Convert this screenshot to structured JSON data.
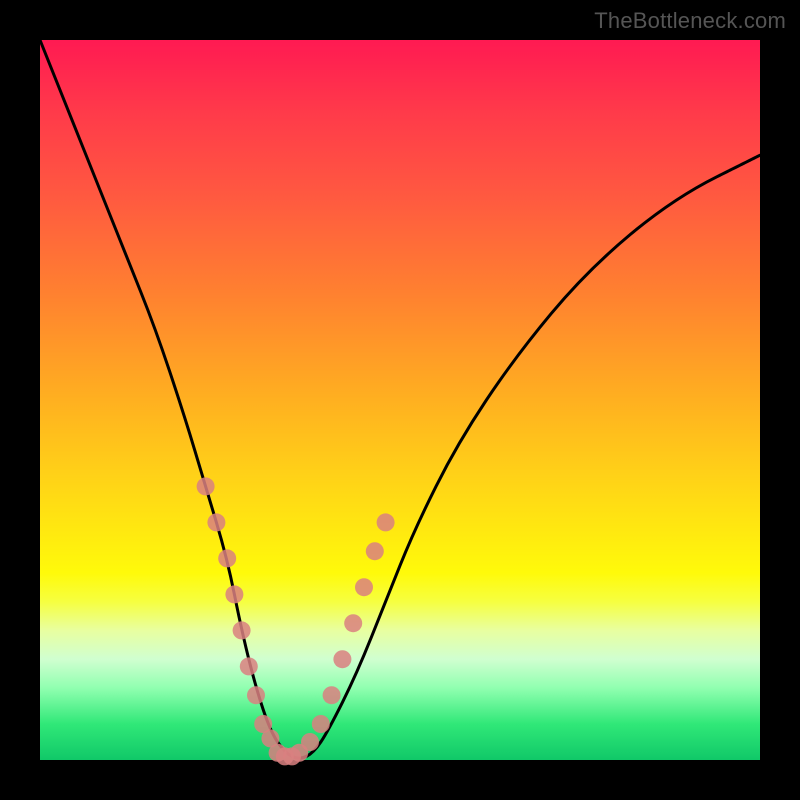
{
  "watermark": "TheBottleneck.com",
  "chart_data": {
    "type": "line",
    "title": "",
    "xlabel": "",
    "ylabel": "",
    "xlim": [
      0,
      100
    ],
    "ylim": [
      0,
      100
    ],
    "background_gradient": {
      "top_color": "#ff1a52",
      "mid_color": "#ffe810",
      "bottom_color": "#10c868",
      "meaning": "red=high bottleneck, green=low bottleneck"
    },
    "series": [
      {
        "name": "bottleneck-curve",
        "x": [
          0,
          4,
          8,
          12,
          16,
          20,
          23,
          26,
          28,
          30,
          32,
          34,
          36,
          38,
          40,
          44,
          48,
          52,
          58,
          66,
          76,
          88,
          100
        ],
        "y": [
          100,
          90,
          80,
          70,
          60,
          48,
          38,
          28,
          18,
          10,
          4,
          1,
          0,
          1,
          4,
          12,
          22,
          32,
          44,
          56,
          68,
          78,
          84
        ],
        "color": "#000000",
        "stroke_width": 3
      }
    ],
    "markers": {
      "name": "sample-points",
      "color": "#d98080",
      "radius": 9,
      "points": [
        {
          "x": 23,
          "y": 38
        },
        {
          "x": 24.5,
          "y": 33
        },
        {
          "x": 26,
          "y": 28
        },
        {
          "x": 27,
          "y": 23
        },
        {
          "x": 28,
          "y": 18
        },
        {
          "x": 29,
          "y": 13
        },
        {
          "x": 30,
          "y": 9
        },
        {
          "x": 31,
          "y": 5
        },
        {
          "x": 32,
          "y": 3
        },
        {
          "x": 33,
          "y": 1
        },
        {
          "x": 34,
          "y": 0.5
        },
        {
          "x": 35,
          "y": 0.5
        },
        {
          "x": 36,
          "y": 1
        },
        {
          "x": 37.5,
          "y": 2.5
        },
        {
          "x": 39,
          "y": 5
        },
        {
          "x": 40.5,
          "y": 9
        },
        {
          "x": 42,
          "y": 14
        },
        {
          "x": 43.5,
          "y": 19
        },
        {
          "x": 45,
          "y": 24
        },
        {
          "x": 46.5,
          "y": 29
        },
        {
          "x": 48,
          "y": 33
        }
      ]
    }
  }
}
